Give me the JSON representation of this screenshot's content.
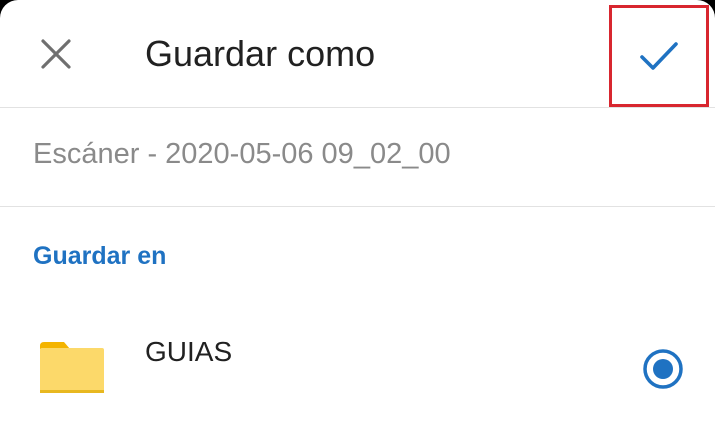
{
  "header": {
    "title": "Guardar como",
    "close_icon": "close-icon",
    "confirm_icon": "check-icon"
  },
  "filename": {
    "value": "Escáner - 2020-05-06 09_02_00"
  },
  "save_location": {
    "section_label": "Guardar en",
    "folder_name": "GUIAS",
    "folder_icon": "folder-icon",
    "selected": true
  },
  "colors": {
    "accent": "#1f72c2",
    "highlight_box": "#d8262f",
    "folder_body": "#fcd96a",
    "folder_tab": "#f4b400"
  }
}
